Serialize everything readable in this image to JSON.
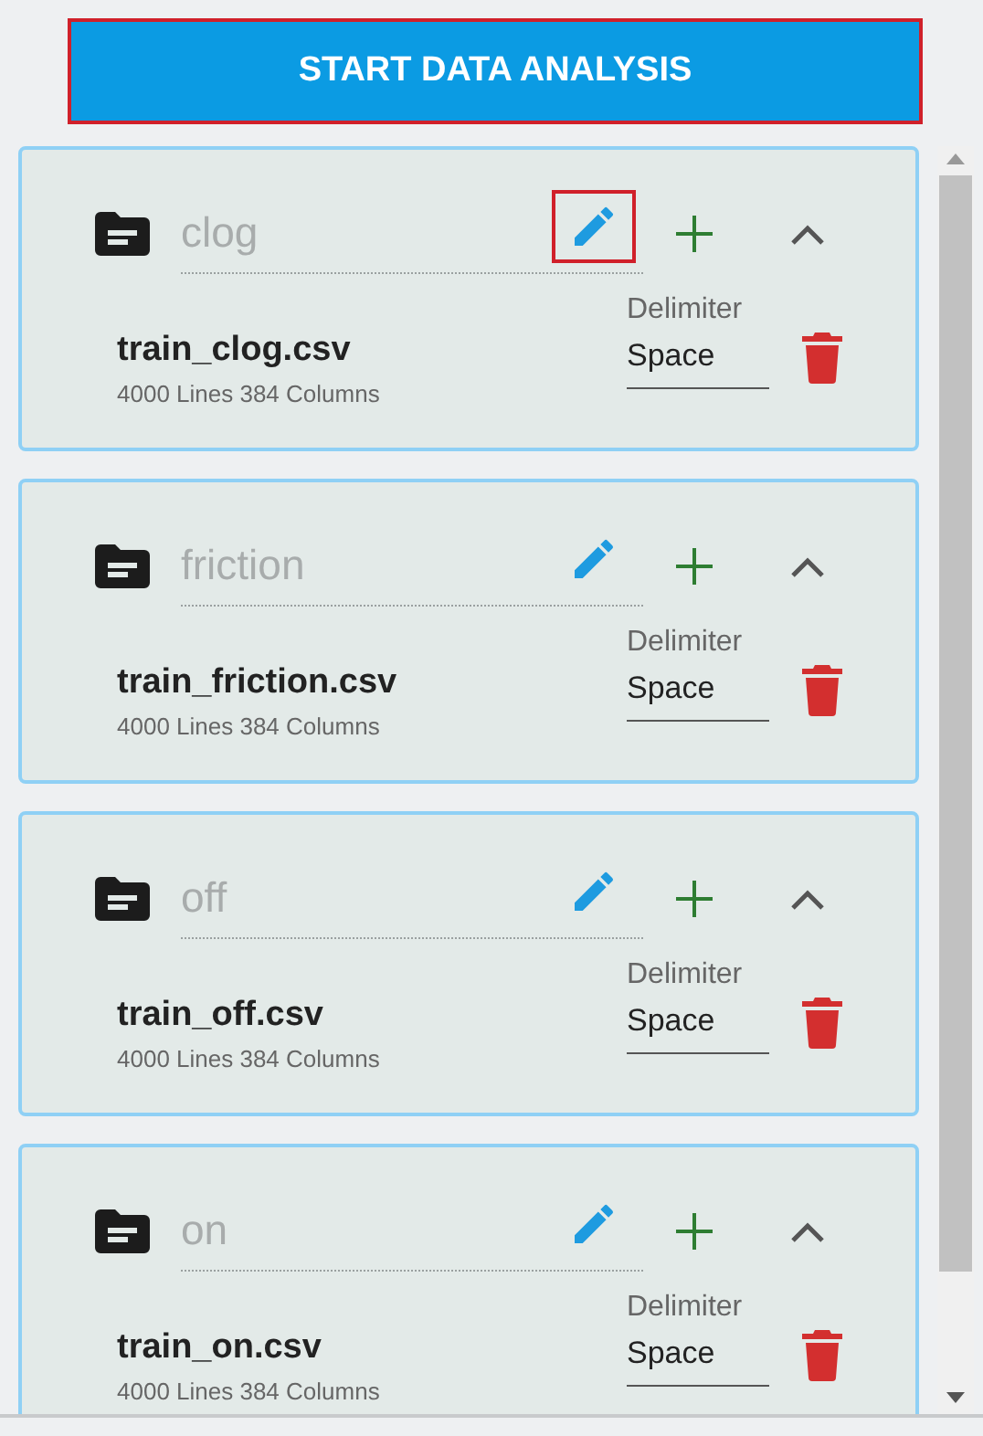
{
  "start_button": {
    "label": "START DATA ANALYSIS",
    "highlighted": true
  },
  "groups": [
    {
      "name": "clog",
      "edit_highlighted": true,
      "expanded": true,
      "file": {
        "filename": "train_clog.csv",
        "info": "4000 Lines 384 Columns",
        "delimiter_label": "Delimiter",
        "delimiter": "Space"
      }
    },
    {
      "name": "friction",
      "edit_highlighted": false,
      "expanded": true,
      "file": {
        "filename": "train_friction.csv",
        "info": "4000 Lines 384 Columns",
        "delimiter_label": "Delimiter",
        "delimiter": "Space"
      }
    },
    {
      "name": "off",
      "edit_highlighted": false,
      "expanded": true,
      "file": {
        "filename": "train_off.csv",
        "info": "4000 Lines 384 Columns",
        "delimiter_label": "Delimiter",
        "delimiter": "Space"
      }
    },
    {
      "name": "on",
      "edit_highlighted": false,
      "expanded": true,
      "file": {
        "filename": "train_on.csv",
        "info": "4000 Lines 384 Columns",
        "delimiter_label": "Delimiter",
        "delimiter": "Space"
      }
    }
  ]
}
